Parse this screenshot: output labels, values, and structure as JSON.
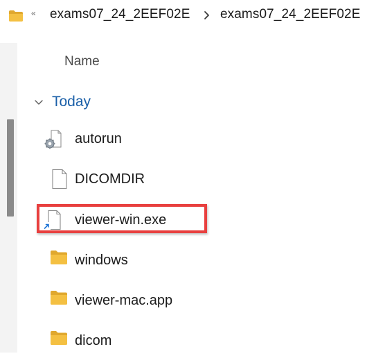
{
  "address_bar": {
    "overflow_glyph": "«",
    "crumbs": [
      "exams07_24_2EEF02E",
      "exams07_24_2EEF02E"
    ],
    "icons": {
      "folder": "folder-icon",
      "separator": "chevron-right-icon"
    }
  },
  "columns": {
    "name": "Name"
  },
  "group": {
    "label": "Today",
    "icon": "chevron-down-icon"
  },
  "files": [
    {
      "name": "autorun",
      "icon": "settings-file-icon"
    },
    {
      "name": "DICOMDIR",
      "icon": "blank-file-icon"
    },
    {
      "name": "viewer-win.exe",
      "icon": "shortcut-file-icon",
      "highlighted": true
    },
    {
      "name": "windows",
      "icon": "folder-icon"
    },
    {
      "name": "viewer-mac.app",
      "icon": "folder-icon"
    },
    {
      "name": "dicom",
      "icon": "folder-icon"
    }
  ],
  "colors": {
    "folder": "#f4c042",
    "folder_dark": "#e0a82e",
    "highlight": "#e8403f",
    "group_label": "#1a5fa8",
    "shortcut_arrow": "#1e74d6"
  }
}
